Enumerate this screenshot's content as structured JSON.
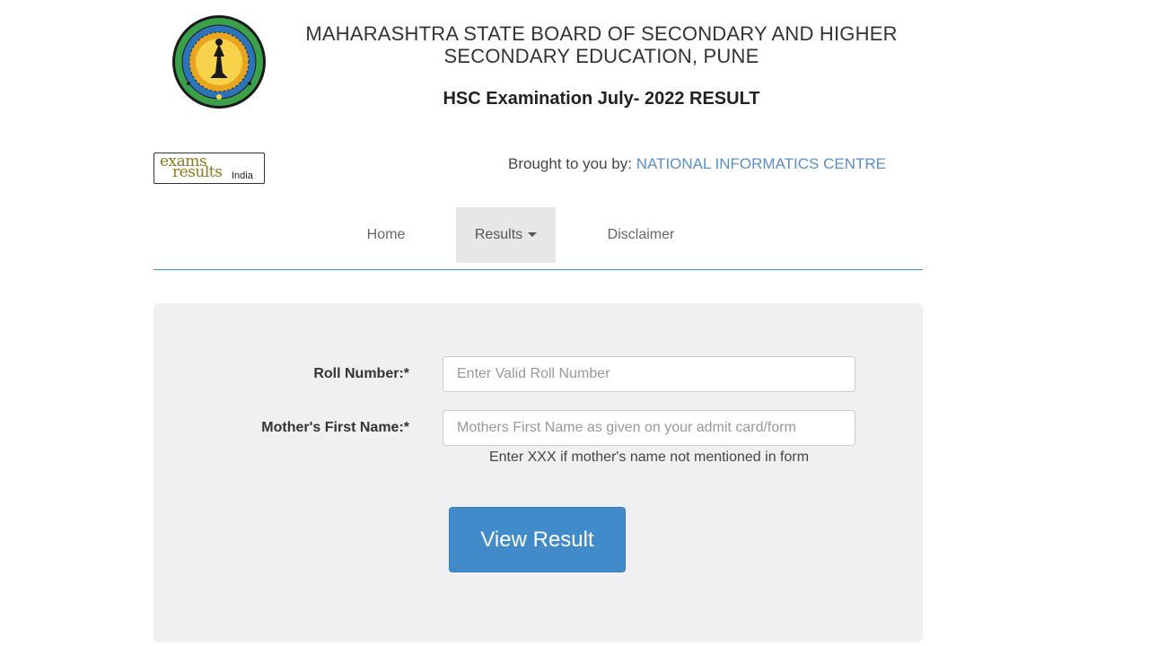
{
  "header": {
    "board_line1": "MAHARASHTRA STATE BOARD OF SECONDARY AND HIGHER",
    "board_line2": "SECONDARY EDUCATION, PUNE",
    "exam_title": "HSC Examination July- 2022 RESULT"
  },
  "logo": {
    "line1": "exams",
    "line2": "results",
    "suffix": "India"
  },
  "credit": {
    "prefix": "Brought to you by: ",
    "org": "NATIONAL INFORMATICS CENTRE"
  },
  "nav": {
    "home": "Home",
    "results": "Results",
    "disclaimer": "Disclaimer"
  },
  "form": {
    "roll_label": "Roll Number:*",
    "roll_placeholder": "Enter Valid Roll Number",
    "mother_label": "Mother's First Name:*",
    "mother_placeholder": "Mothers First Name as given on your admit card/form",
    "mother_hint": "Enter XXX if mother's name not mentioned in form",
    "submit_label": "View Result"
  },
  "colors": {
    "accent": "#428bca",
    "nav_rule": "#25a7a3",
    "credit_link": "#5b8fc9",
    "panel_bg": "#f0f0f2"
  }
}
